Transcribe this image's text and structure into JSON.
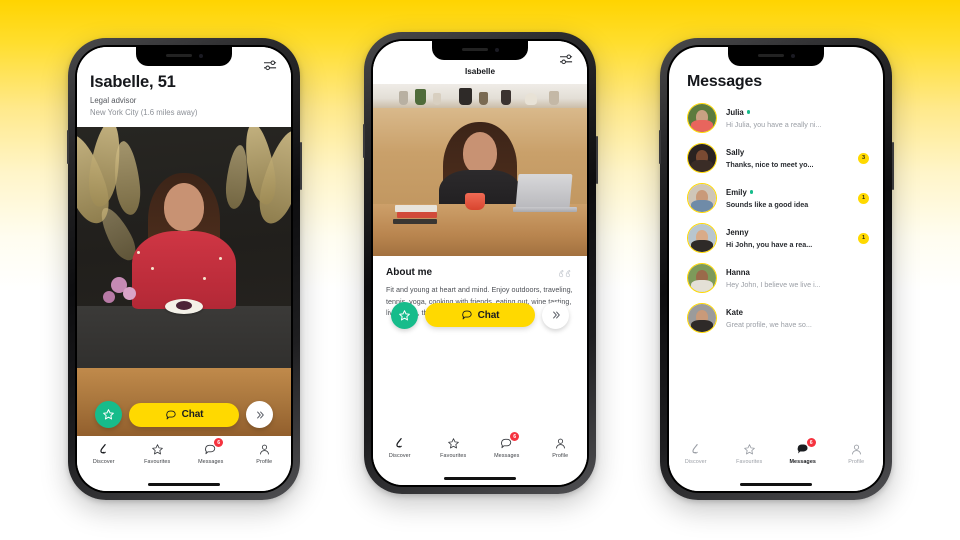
{
  "theme": {
    "bg_top": "#FFD400",
    "bg_bottom": "#FFFFFF",
    "accent_yellow": "#FFD900",
    "accent_green": "#17BC8B",
    "badge_red": "#F5333F"
  },
  "phone1": {
    "screen_name": "profile-card",
    "profile": {
      "name_age": "Isabelle, 51",
      "occupation": "Legal advisor",
      "location": "New York City (1.6 miles away)"
    },
    "filter_icon": "filter-sliders-icon",
    "actions": {
      "favourite_icon": "star-icon",
      "chat_label": "Chat",
      "chat_icon": "speech-bubble-icon",
      "next_icon": "double-chevron-right-icon"
    },
    "tabs": [
      {
        "label": "Discover",
        "icon": "lightning-icon",
        "active": true,
        "badge": ""
      },
      {
        "label": "Favourites",
        "icon": "star-icon",
        "active": false,
        "badge": ""
      },
      {
        "label": "Messages",
        "icon": "speech-bubble-icon",
        "active": false,
        "badge": "6"
      },
      {
        "label": "Profile",
        "icon": "person-icon",
        "active": false,
        "badge": ""
      }
    ]
  },
  "phone2": {
    "screen_name": "profile-detail",
    "header_title": "Isabelle",
    "filter_icon": "filter-sliders-icon",
    "about": {
      "title": "About me",
      "quote_icon": "quotation-mark-icon",
      "text": "Fit and young at heart and mind. Enjoy outdoors, traveling, tennis, yoga, cooking with friends, eating out, wine tasting, live music, theatre. Comfortable in jeans and"
    },
    "actions": {
      "favourite_icon": "star-icon",
      "chat_label": "Chat",
      "chat_icon": "speech-bubble-icon",
      "next_icon": "double-chevron-right-icon"
    },
    "tabs": [
      {
        "label": "Discover",
        "icon": "lightning-icon",
        "active": true,
        "badge": ""
      },
      {
        "label": "Favourites",
        "icon": "star-icon",
        "active": false,
        "badge": ""
      },
      {
        "label": "Messages",
        "icon": "speech-bubble-icon",
        "active": false,
        "badge": "6"
      },
      {
        "label": "Profile",
        "icon": "person-icon",
        "active": false,
        "badge": ""
      }
    ]
  },
  "phone3": {
    "screen_name": "messages-list",
    "title": "Messages",
    "conversations": [
      {
        "name": "Julia",
        "online": true,
        "preview": "Hi Julia, you have a really ni...",
        "unread": false,
        "badge": "",
        "avatar_bg": "#5c7b3e",
        "avatar_skin": "#caa183",
        "avatar_cloth": "#e8655d"
      },
      {
        "name": "Sally",
        "online": false,
        "preview": "Thanks, nice to meet yo...",
        "unread": true,
        "badge": "3",
        "avatar_bg": "#2a2220",
        "avatar_skin": "#7a4a32",
        "avatar_cloth": "#3a2c26"
      },
      {
        "name": "Emily",
        "online": true,
        "preview": "Sounds like a good idea",
        "unread": true,
        "badge": "1",
        "avatar_bg": "#cfc6b8",
        "avatar_skin": "#c99a79",
        "avatar_cloth": "#6f8ba8"
      },
      {
        "name": "Jenny",
        "online": false,
        "preview": "Hi John, you have a rea...",
        "unread": true,
        "badge": "1",
        "avatar_bg": "#b8c6cf",
        "avatar_skin": "#d9ab88",
        "avatar_cloth": "#2e2a28"
      },
      {
        "name": "Hanna",
        "online": false,
        "preview": "Hey John, I believe we live i...",
        "unread": false,
        "badge": "",
        "avatar_bg": "#7d9a5a",
        "avatar_skin": "#9a6a4a",
        "avatar_cloth": "#e4e0d6"
      },
      {
        "name": "Kate",
        "online": false,
        "preview": "Great profile, we have so...",
        "unread": false,
        "badge": "",
        "avatar_bg": "#9b9b9b",
        "avatar_skin": "#c99a79",
        "avatar_cloth": "#2e2a28"
      }
    ],
    "tabs": [
      {
        "label": "Discover",
        "icon": "lightning-icon",
        "active": false,
        "badge": ""
      },
      {
        "label": "Favourites",
        "icon": "star-icon",
        "active": false,
        "badge": ""
      },
      {
        "label": "Messages",
        "icon": "speech-bubble-icon",
        "active": true,
        "badge": "6"
      },
      {
        "label": "Profile",
        "icon": "person-icon",
        "active": false,
        "badge": ""
      }
    ]
  }
}
